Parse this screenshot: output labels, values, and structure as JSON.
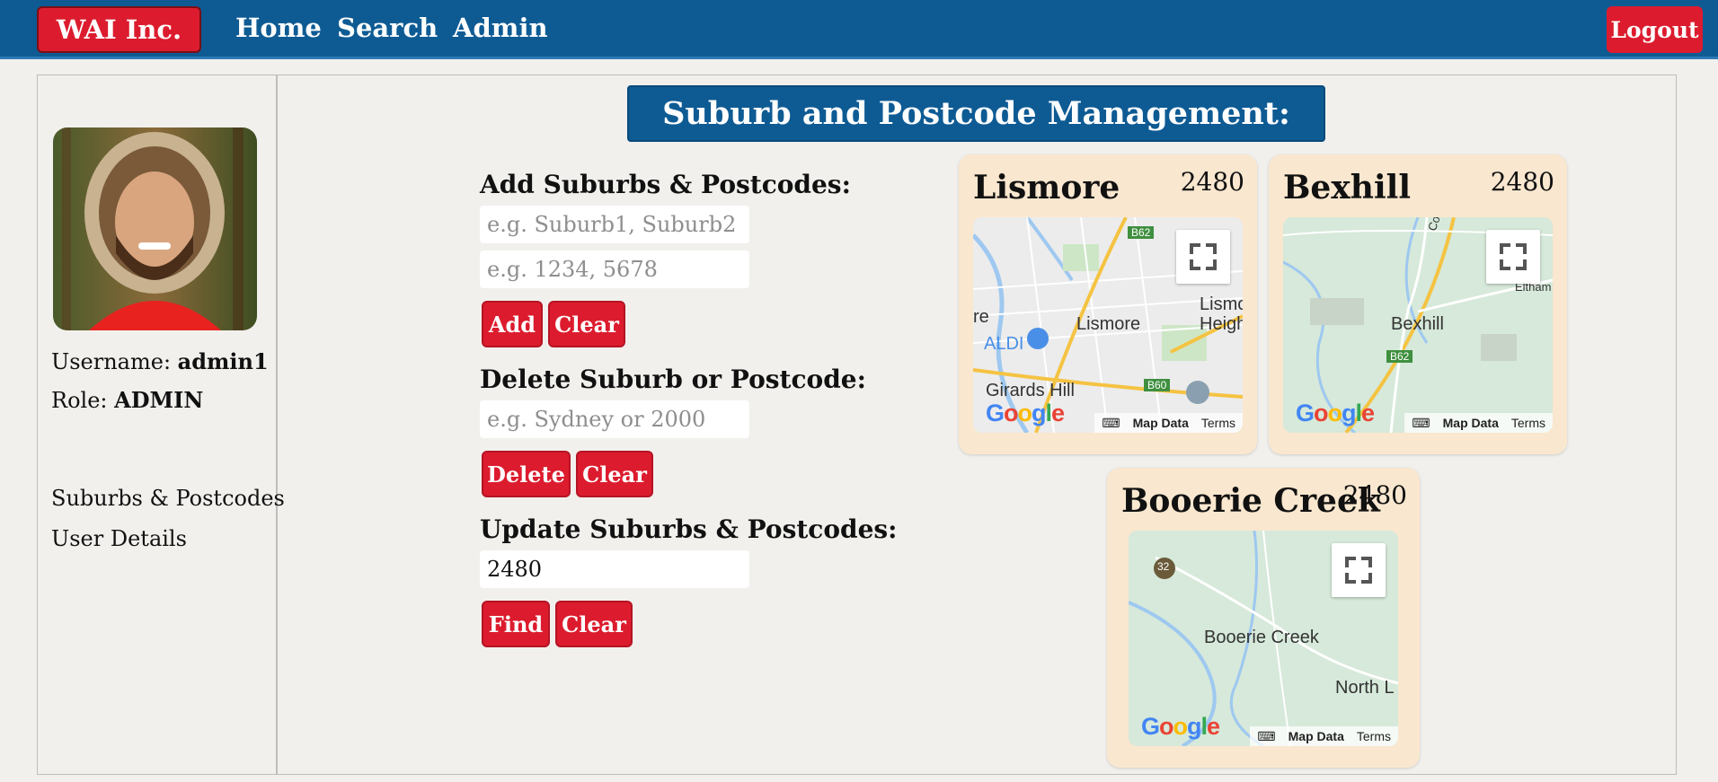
{
  "navbar": {
    "brand": "WAI Inc.",
    "links": [
      "Home",
      "Search",
      "Admin"
    ],
    "logout": "Logout"
  },
  "sidebar": {
    "username_label": "Username:",
    "username": "admin1",
    "role_label": "Role:",
    "role": "ADMIN",
    "links": [
      "Suburbs & Postcodes",
      "User Details"
    ]
  },
  "main": {
    "title": "Suburb and Postcode Management:",
    "add": {
      "label": "Add Suburbs & Postcodes:",
      "suburbs_placeholder": "e.g. Suburb1, Suburb2",
      "postcodes_placeholder": "e.g. 1234, 5678",
      "add_button": "Add",
      "clear_button": "Clear"
    },
    "delete": {
      "label": "Delete Suburb or Postcode:",
      "placeholder": "e.g. Sydney or 2000",
      "delete_button": "Delete",
      "clear_button": "Clear"
    },
    "update": {
      "label": "Update Suburbs & Postcodes:",
      "value": "2480",
      "find_button": "Find",
      "clear_button": "Clear"
    }
  },
  "cards": [
    {
      "name": "Lismore",
      "postcode": "2480",
      "map_labels": [
        "Lismore",
        "ALDI",
        "Girards Hill",
        "Lismo",
        "Heigh",
        "re",
        "B62",
        "B60"
      ]
    },
    {
      "name": "Bexhill",
      "postcode": "2480",
      "map_labels": [
        "Bexhill",
        "Corndale Rd",
        "Eltham",
        "B62"
      ]
    },
    {
      "name": "Booerie Creek",
      "postcode": "2480",
      "map_labels": [
        "Booerie Creek",
        "North L",
        "32"
      ]
    }
  ],
  "map_footer": {
    "google": "Google",
    "map_data": "Map Data",
    "terms": "Terms"
  },
  "colors": {
    "navbar": "#0e5b94",
    "accent_red": "#dc1c2e",
    "card_bg": "#f9e7cf",
    "page_bg": "#f1f0ed"
  }
}
